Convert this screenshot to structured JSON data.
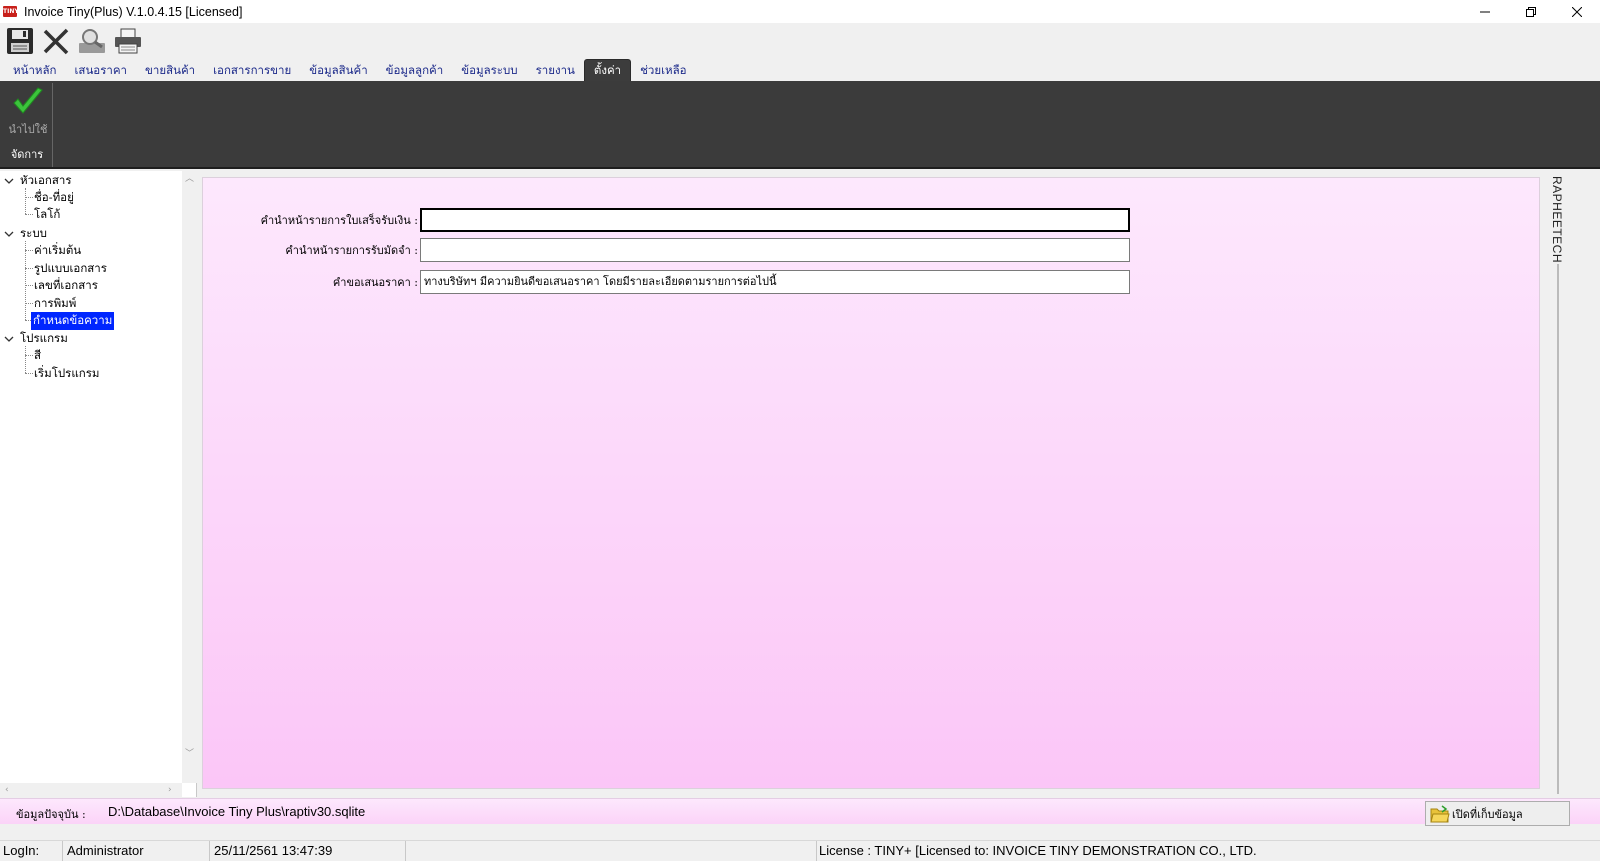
{
  "window": {
    "title": "Invoice Tiny(Plus)  V.1.0.4.15 [Licensed]",
    "logo_text": "TINY"
  },
  "toolbar": {
    "buttons": [
      "save-icon",
      "cancel-icon",
      "preview-icon",
      "print-icon"
    ]
  },
  "menu": {
    "tabs": [
      {
        "label": "หน้าหลัก"
      },
      {
        "label": "เสนอราคา"
      },
      {
        "label": "ขายสินค้า"
      },
      {
        "label": "เอกสารการขาย"
      },
      {
        "label": "ข้อมูลสินค้า"
      },
      {
        "label": "ข้อมูลลูกค้า"
      },
      {
        "label": "ข้อมูลระบบ"
      },
      {
        "label": "รายงาน"
      },
      {
        "label": "ตั้งค่า"
      },
      {
        "label": "ช่วยเหลือ"
      }
    ],
    "active_index": 8
  },
  "ribbon": {
    "apply_label": "นำไปใช้",
    "group_label": "จัดการ"
  },
  "tree": {
    "groups": [
      {
        "label": "หัวเอกสาร",
        "children": [
          "ชื่อ-ที่อยู่",
          "โลโก้"
        ]
      },
      {
        "label": "ระบบ",
        "children": [
          "ค่าเริ่มต้น",
          "รูปแบบเอกสาร",
          "เลขที่เอกสาร",
          "การพิมพ์",
          "กำหนดข้อความ"
        ]
      },
      {
        "label": "โปรแกรม",
        "children": [
          "สี",
          "เริ่มโปรแกรม"
        ]
      }
    ],
    "selected": "กำหนดข้อความ"
  },
  "form": {
    "fields": [
      {
        "label": "คำนำหน้ารายการใบเสร็จรับเงิน :",
        "value": ""
      },
      {
        "label": "คำนำหน้ารายการรับมัดจำ :",
        "value": ""
      },
      {
        "label": "คำขอเสนอราคา :",
        "value": "ทางบริษัทฯ มีความยินดีขอเสนอราคา โดยมีรายละเอียดตามรายการต่อไปนี้"
      }
    ]
  },
  "side_brand": "RAPHEETECH",
  "db_bar": {
    "label": "ข้อมูลปัจจุบัน :",
    "path": "D:\\Database\\Invoice Tiny Plus\\raptiv30.sqlite",
    "open_button_label": "เปิดที่เก็บข้อมูล"
  },
  "status": {
    "login_label": "LogIn:",
    "user": "Administrator",
    "datetime": "25/11/2561 13:47:39",
    "license": "License : TINY+ [Licensed to: INVOICE TINY DEMONSTRATION CO., LTD."
  },
  "colors": {
    "ribbon_bg": "#3b3b3b",
    "selected_tree": "#0026ff",
    "content_gradient_top": "#fde8fd",
    "content_gradient_bottom": "#fbc6f7",
    "menu_text": "#1c2a8a"
  }
}
